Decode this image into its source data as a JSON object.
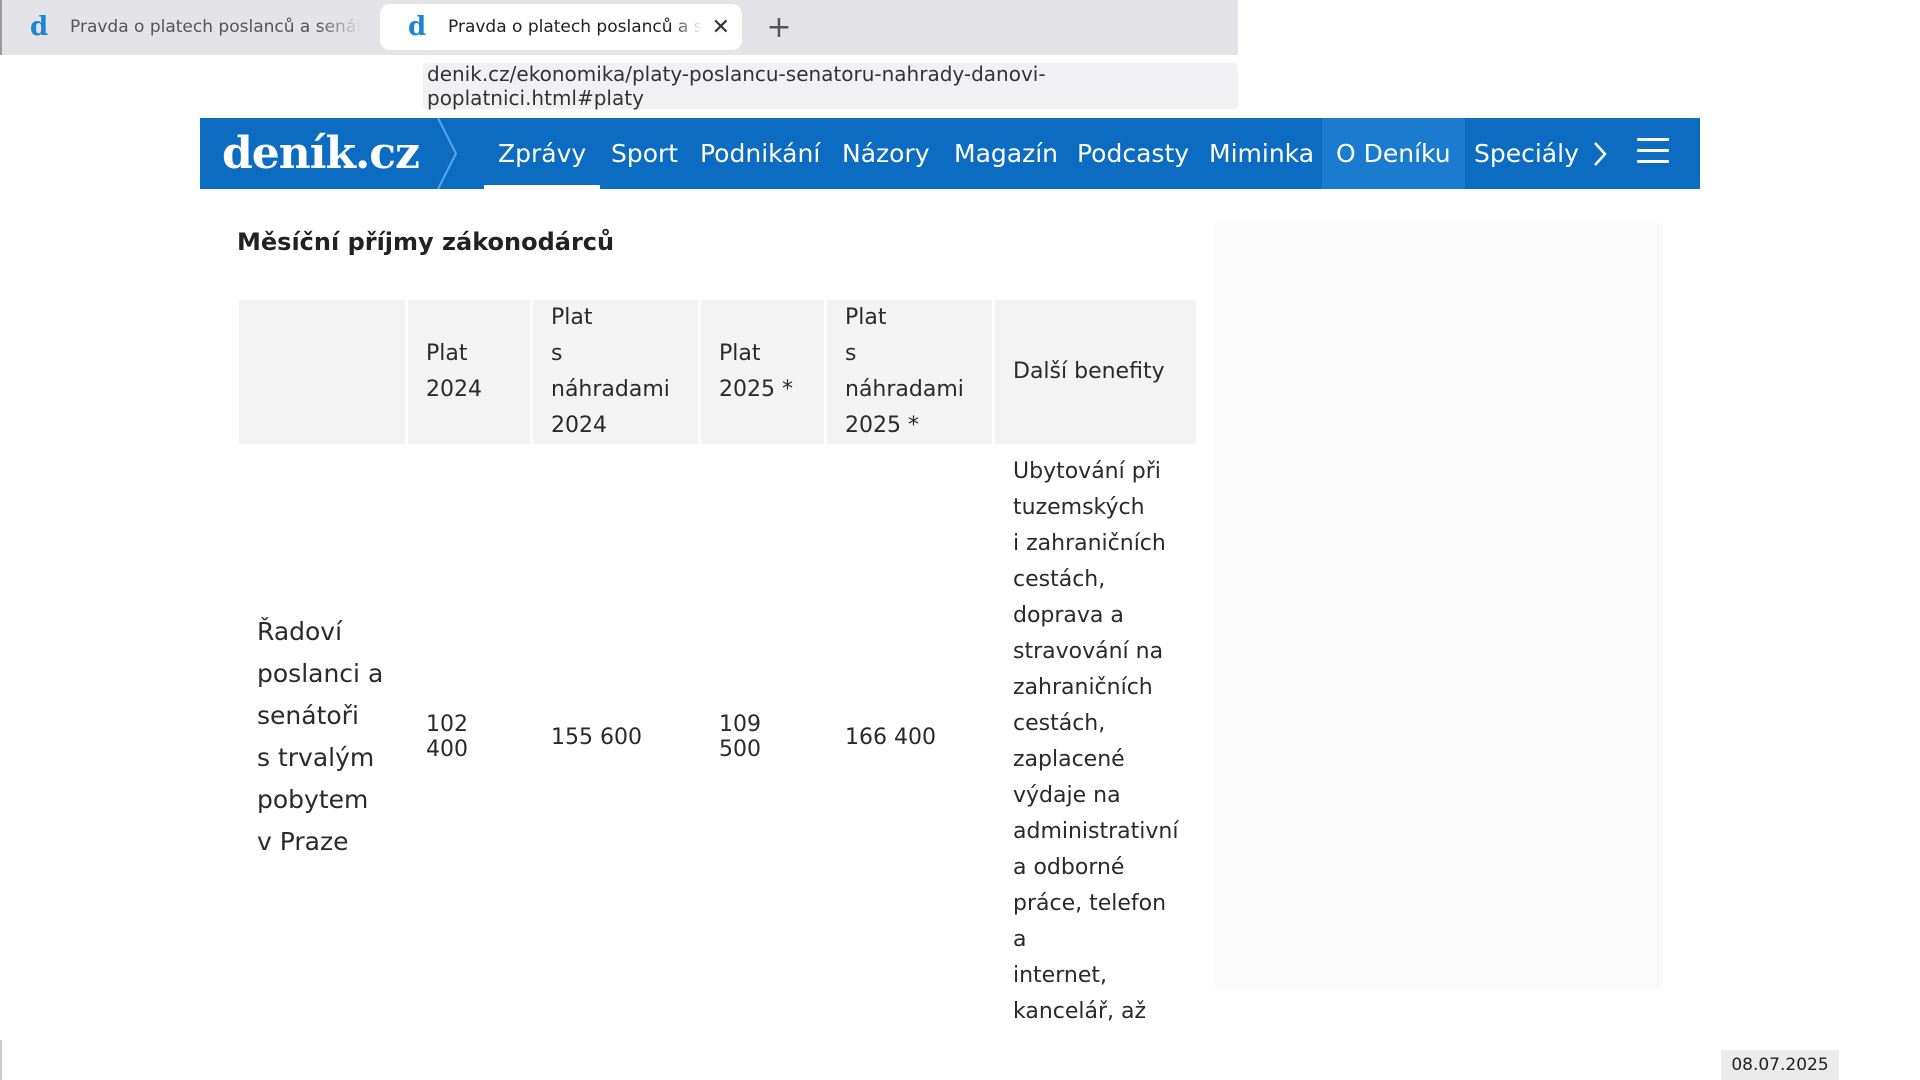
{
  "browser": {
    "tabs": [
      {
        "title": "Pravda o platech poslanců a senátorů",
        "active": false
      },
      {
        "title": "Pravda o platech poslanců a senátorů",
        "active": true
      }
    ],
    "favicon_letter": "d",
    "new_tab_symbol": "+",
    "close_symbol": "✕",
    "url": "denik.cz/ekonomika/platy-poslancu-senatoru-nahrady-danovi-poplatnici.html#platy"
  },
  "site": {
    "logo": "deník.cz",
    "nav": [
      "Zprávy",
      "Sport",
      "Podnikání",
      "Názory",
      "Magazín",
      "Podcasty",
      "Miminka",
      "O Deníku",
      "Speciály"
    ],
    "active_nav": "Zprávy",
    "colors": {
      "brand_blue": "#0b6cc2",
      "highlight_blue": "#1b7bcf"
    }
  },
  "article": {
    "table_title": "Měsíční příjmy zákonodárců",
    "headers": [
      "",
      "Plat\n2024",
      "Plat\ns náhradami\n2024",
      "Plat\n2025 *",
      "Plat\ns náhradami\n2025 *",
      "Další benefity"
    ],
    "rows": [
      {
        "label": "Řadoví\nposlanci a\nsenátoři\ns trvalým\npobytem\nv Praze",
        "plat_2024": "102 400",
        "plat_nahrady_2024": "155 600",
        "plat_2025": "109 500",
        "plat_nahrady_2025": "166 400",
        "benefits": "Ubytování při\ntuzemských\ni zahraničních\ncestách,\ndoprava a\nstravování na\nzahraničních\ncestách,\nzaplacené\nvýdaje na\nadministrativní\na odborné\npráce, telefon a\ninternet,\nkancelář, až"
      }
    ]
  },
  "date_stamp": "08.07.2025"
}
